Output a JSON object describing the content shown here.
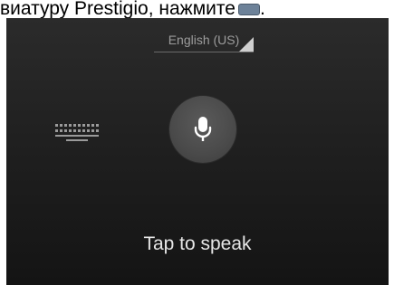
{
  "doc_text": {
    "caption": "виатуру Prestigio, нажмите",
    "caption_end": "."
  },
  "voice": {
    "language": "English (US)",
    "prompt": "Tap to speak"
  },
  "icons": {
    "inline_key": "keyboard-key-icon",
    "keyboard": "keyboard-icon",
    "mic": "microphone-icon"
  },
  "colors": {
    "background": "#1f1f1f",
    "mic_button": "#4a4a4a",
    "prompt_text": "#e6e6e6",
    "language_text": "#9c9c9c"
  }
}
